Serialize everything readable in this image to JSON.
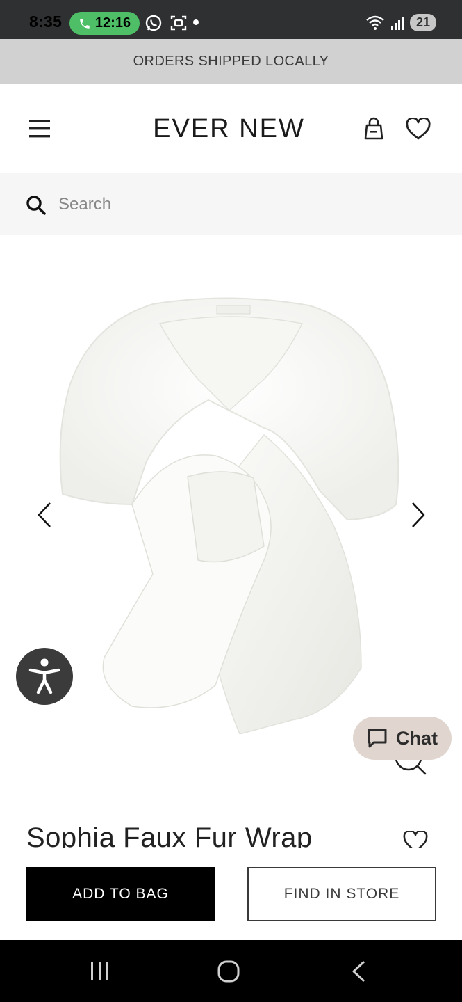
{
  "status_bar": {
    "time": "8:35",
    "call_timer": "12:16",
    "battery": "21"
  },
  "promo_banner": {
    "text": "ORDERS SHIPPED LOCALLY"
  },
  "header": {
    "logo": "EVER NEW",
    "icons": [
      "menu-icon",
      "bag-icon",
      "heart-icon"
    ]
  },
  "search": {
    "placeholder": "Search"
  },
  "product": {
    "title": "Sophia Faux Fur Wrap",
    "image_description_icon": "zoom-icon"
  },
  "chat": {
    "label": "Chat"
  },
  "actions": {
    "add_to_bag": "ADD TO BAG",
    "find_in_store": "FIND IN STORE"
  },
  "colors": {
    "status_bar": "#2f3032",
    "call_pill": "#4fbf67",
    "promo_bg": "#d1d1d1",
    "chat_bg": "#e0d6cf",
    "primary_button": "#000000"
  }
}
